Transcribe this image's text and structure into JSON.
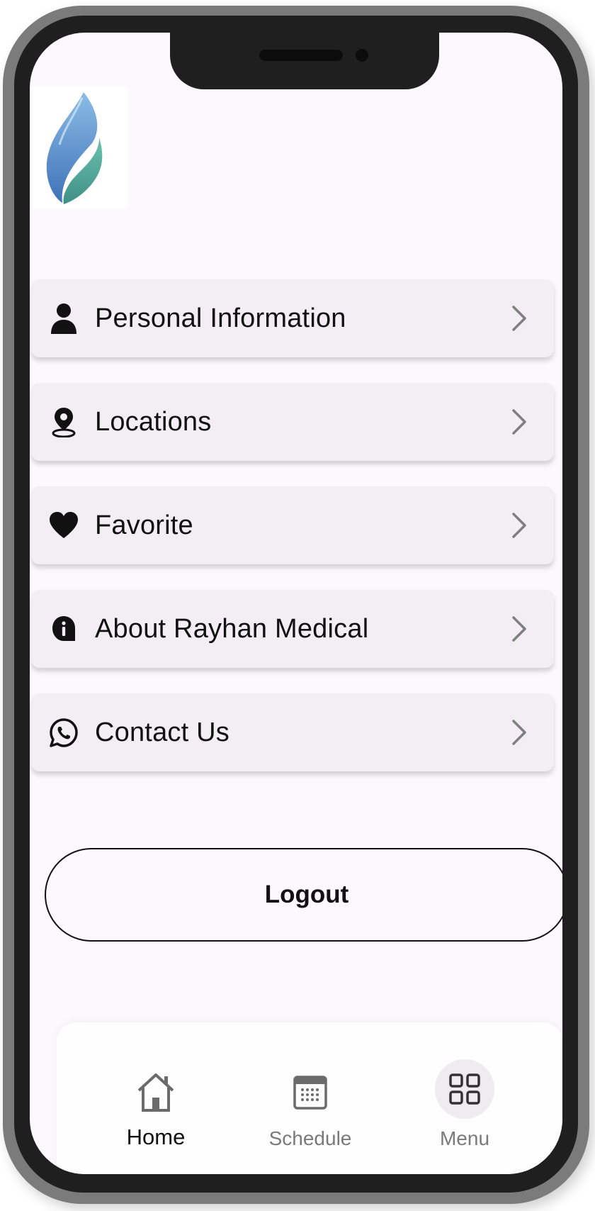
{
  "menu": {
    "items": [
      {
        "label": "Personal Information",
        "icon": "person-icon"
      },
      {
        "label": "Locations",
        "icon": "location-pin-icon"
      },
      {
        "label": "Favorite",
        "icon": "heart-icon"
      },
      {
        "label": "About Rayhan Medical",
        "icon": "info-icon"
      },
      {
        "label": "Contact Us",
        "icon": "whatsapp-icon"
      }
    ]
  },
  "logout": {
    "label": "Logout"
  },
  "bottom_nav": {
    "items": [
      {
        "label": "Home",
        "icon": "home-icon",
        "active": true
      },
      {
        "label": "Schedule",
        "icon": "calendar-icon",
        "active": false
      },
      {
        "label": "Menu",
        "icon": "grid-icon",
        "active": false
      }
    ]
  },
  "colors": {
    "screen_background": "#fbf9fb",
    "card_background": "#f2eef4",
    "text_primary": "#111111",
    "text_muted": "#7a7a7a",
    "logo_blue": "#4f86c6",
    "logo_green": "#5bb3a0"
  }
}
